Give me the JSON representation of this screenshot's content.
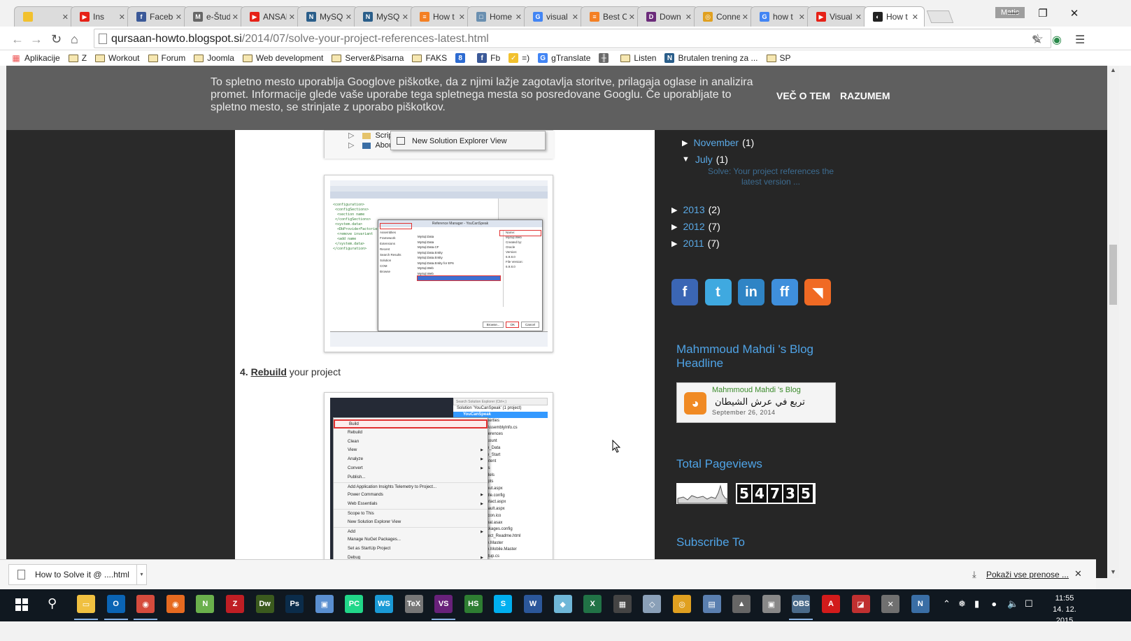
{
  "browser": {
    "tabs": [
      {
        "label": "",
        "color": "#f2c12e",
        "glyph": ""
      },
      {
        "label": "Ins",
        "color": "#e62117",
        "glyph": "▶"
      },
      {
        "label": "Facebo",
        "color": "#3b5998",
        "glyph": "f"
      },
      {
        "label": "e-Študi",
        "color": "#666666",
        "glyph": "M"
      },
      {
        "label": "ANSAI",
        "color": "#e62117",
        "glyph": "▶"
      },
      {
        "label": "MySQ",
        "color": "#2a5e8a",
        "glyph": "N"
      },
      {
        "label": "MySQ",
        "color": "#2a5e8a",
        "glyph": "N"
      },
      {
        "label": "How t",
        "color": "#f48024",
        "glyph": "≡"
      },
      {
        "label": "Home",
        "color": "#6a8fb0",
        "glyph": "□"
      },
      {
        "label": "visual",
        "color": "#4285f4",
        "glyph": "G"
      },
      {
        "label": "Best C",
        "color": "#f48024",
        "glyph": "≡"
      },
      {
        "label": "Down",
        "color": "#6b2b7a",
        "glyph": "D"
      },
      {
        "label": "Conne",
        "color": "#e0a020",
        "glyph": "◎"
      },
      {
        "label": "how t",
        "color": "#4285f4",
        "glyph": "G"
      },
      {
        "label": "Visual",
        "color": "#e62117",
        "glyph": "▶"
      },
      {
        "label": "How t",
        "color": "#222222",
        "glyph": "◐",
        "active": true
      }
    ],
    "user_badge": "Matic",
    "url": {
      "host": "qursaan-howto.blogspot.si",
      "path": "/2014/07/solve-your-project-references-latest.html"
    },
    "bookmarks": [
      {
        "label": "Aplikacije",
        "kind": "apps"
      },
      {
        "label": "Z",
        "kind": "folder"
      },
      {
        "label": "Workout",
        "kind": "folder"
      },
      {
        "label": "Forum",
        "kind": "folder"
      },
      {
        "label": "Joomla",
        "kind": "folder"
      },
      {
        "label": "Web development",
        "kind": "folder"
      },
      {
        "label": "Server&Pisarna",
        "kind": "folder"
      },
      {
        "label": "FAKS",
        "kind": "folder"
      },
      {
        "label": "",
        "kind": "icon",
        "color": "#2d6bd1",
        "glyph": "8"
      },
      {
        "label": "Fb",
        "kind": "icon",
        "color": "#3b5998",
        "glyph": "f"
      },
      {
        "label": "=)",
        "kind": "icon",
        "color": "#f2c12e",
        "glyph": "✓"
      },
      {
        "label": "gTranslate",
        "kind": "icon",
        "color": "#4285f4",
        "glyph": "G"
      },
      {
        "label": "",
        "kind": "icon",
        "color": "#6a6a6a",
        "glyph": "╫"
      },
      {
        "label": "Listen",
        "kind": "folder"
      },
      {
        "label": "Brutalen trening za ...",
        "kind": "icon",
        "color": "#2a5e8a",
        "glyph": "N"
      },
      {
        "label": "SP",
        "kind": "folder"
      }
    ]
  },
  "cookie_bar": {
    "text": "To spletno mesto uporablja Googlove piškotke, da z njimi lažje zagotavlja storitve, prilagaja oglase in analizira promet. Informacije glede vaše uporabe tega spletnega mesta so posredovane Googlu. Če uporabljate to spletno mesto, se strinjate z uporabo piškotkov.",
    "more_label": "VEČ O TEM",
    "accept_label": "RAZUMEM"
  },
  "post": {
    "shot1_menu_item": "New Solution Explorer View",
    "shot1_tree": [
      "Scrip",
      "About.aspx"
    ],
    "step_number": "4.",
    "step_link": "Rebuild",
    "step_rest": " your project",
    "shot2_dialog_title": "Reference Manager - YouCanSpeak",
    "shot2_left_items": [
      "Assemblies",
      "Framework",
      "Extensions",
      "Recent",
      "Search Results",
      "Solution",
      "COM",
      "Browse"
    ],
    "shot2_rows": [
      "MySql.Data",
      "MySql.Data",
      "MySql.Data.CF",
      "MySql.Data.Entity",
      "MySql.Data.Entity",
      "MySql.Data.Entity for EF6",
      "MySql.Web",
      "MySql.Web",
      "MySql.Web"
    ],
    "shot3_menu": [
      "Build",
      "Rebuild",
      "Clean",
      "View",
      "Analyze",
      "Convert",
      "Publish...",
      "Add Application Insights Telemetry to Project...",
      "Power Commands",
      "Web Essentials",
      "Scope to This",
      "New Solution Explorer View",
      "Add",
      "Manage NuGet Packages...",
      "Set as StartUp Project",
      "Debug"
    ],
    "shot3_solution_header": "Search Solution Explorer (Ctrl+;)",
    "shot3_solution_root": "Solution 'YouCanSpeak' (1 project)",
    "shot3_project": "YouCanSpeak",
    "shot3_files": [
      "perties",
      "AssemblyInfo.cs",
      "ferences",
      "count",
      "p_Data",
      "p_Start",
      "ntent",
      "ts",
      "dels",
      "ipts",
      "out.aspx",
      "dle.config",
      "ntact.aspx",
      "fault.aspx",
      "icon.ico",
      "bal.asax",
      "ckages.config",
      "ject_Readme.html",
      "e.Master",
      "e.Mobile.Master",
      "rtup.cs"
    ]
  },
  "sidebar": {
    "archive": [
      {
        "label": "November",
        "count": "(1)",
        "open": false,
        "level": 2
      },
      {
        "label": "July",
        "count": "(1)",
        "open": true,
        "level": 2
      },
      {
        "label": "2013",
        "count": "(2)",
        "open": false,
        "level": 1
      },
      {
        "label": "2012",
        "count": "(7)",
        "open": false,
        "level": 1
      },
      {
        "label": "2011",
        "count": "(7)",
        "open": false,
        "level": 1
      }
    ],
    "archive_post": "Solve: Your project references the latest version ...",
    "social": [
      {
        "name": "facebook",
        "glyph": "f",
        "color": "#3b66b4"
      },
      {
        "name": "twitter",
        "glyph": "t",
        "color": "#3fa9e0"
      },
      {
        "name": "linkedin",
        "glyph": "in",
        "color": "#2f84c5"
      },
      {
        "name": "friendfeed",
        "glyph": "ff",
        "color": "#3f8fdc"
      },
      {
        "name": "rss",
        "glyph": "◥",
        "color": "#f06a24"
      }
    ],
    "headline_title": "Mahmmoud Mahdi 's Blog Headline",
    "feed_name": "Mahmmoud Mahdi 's Blog",
    "feed_item": "تربع في عرش الشيطان",
    "feed_date": "September 26, 2014",
    "pageviews_title": "Total Pageviews",
    "pageviews_digits": [
      "5",
      "4",
      "7",
      "3",
      "5"
    ],
    "subscribe_title": "Subscribe To"
  },
  "downloads": {
    "file": "How to Solve it @ ....html",
    "show_all": "Pokaži vse prenose ..."
  },
  "taskbar": {
    "time": "11:55",
    "date": "14. 12. 2015",
    "apps": [
      {
        "name": "file-explorer",
        "color": "#f0c040",
        "glyph": "▭",
        "running": true
      },
      {
        "name": "outlook",
        "color": "#0a64b4",
        "glyph": "O",
        "running": true
      },
      {
        "name": "chrome",
        "color": "#d54b3d",
        "glyph": "◉",
        "running": true
      },
      {
        "name": "firefox",
        "color": "#e66a20",
        "glyph": "◉",
        "running": false
      },
      {
        "name": "notepad-plus",
        "color": "#6ab04c",
        "glyph": "N",
        "running": false
      },
      {
        "name": "filezilla",
        "color": "#bf1e24",
        "glyph": "Z",
        "running": false
      },
      {
        "name": "dreamweaver",
        "color": "#3b5a1e",
        "glyph": "Dw",
        "running": false
      },
      {
        "name": "photoshop",
        "color": "#0b2c4a",
        "glyph": "Ps",
        "running": false
      },
      {
        "name": "virtualbox",
        "color": "#5a8fd0",
        "glyph": "▣",
        "running": false
      },
      {
        "name": "pycharm",
        "color": "#21d789",
        "glyph": "PC",
        "running": false
      },
      {
        "name": "webstorm",
        "color": "#1a9ad6",
        "glyph": "WS",
        "running": false
      },
      {
        "name": "latex",
        "color": "#777777",
        "glyph": "TeX",
        "running": false
      },
      {
        "name": "visual-studio",
        "color": "#68217a",
        "glyph": "VS",
        "running": true
      },
      {
        "name": "heidisql",
        "color": "#2e7d32",
        "glyph": "HS",
        "running": false
      },
      {
        "name": "skype",
        "color": "#00aff0",
        "glyph": "S",
        "running": false
      },
      {
        "name": "word",
        "color": "#2b579a",
        "glyph": "W",
        "running": false
      },
      {
        "name": "sketchup",
        "color": "#6fb7d8",
        "glyph": "◆",
        "running": false
      },
      {
        "name": "excel",
        "color": "#217346",
        "glyph": "X",
        "running": false
      },
      {
        "name": "calculator",
        "color": "#444444",
        "glyph": "▦",
        "running": false
      },
      {
        "name": "3d-app",
        "color": "#8aa0b8",
        "glyph": "◇",
        "running": false
      },
      {
        "name": "yellow-app",
        "color": "#e0a020",
        "glyph": "◎",
        "running": false
      },
      {
        "name": "network-app",
        "color": "#5a7fb0",
        "glyph": "▤",
        "running": false
      },
      {
        "name": "graduation-app",
        "color": "#666666",
        "glyph": "▲",
        "running": false
      },
      {
        "name": "printer-app",
        "color": "#888888",
        "glyph": "▣",
        "running": false
      },
      {
        "name": "obs",
        "color": "#4a6a8a",
        "glyph": "OBS",
        "running": true
      },
      {
        "name": "acrobat",
        "color": "#d21b1b",
        "glyph": "A",
        "running": false
      },
      {
        "name": "red-tool",
        "color": "#c03030",
        "glyph": "◪",
        "running": false
      },
      {
        "name": "tools-app",
        "color": "#707070",
        "glyph": "✕",
        "running": false
      },
      {
        "name": "mysql-workbench",
        "color": "#3a6ea5",
        "glyph": "N",
        "running": false
      }
    ]
  }
}
